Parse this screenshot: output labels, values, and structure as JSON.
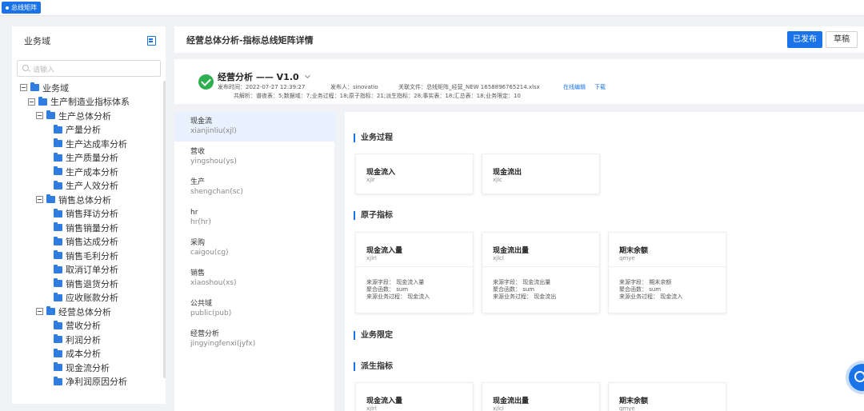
{
  "top_tab": {
    "label": "总线矩阵"
  },
  "sidebar": {
    "title": "业务域",
    "search_placeholder": "请输入",
    "tree": [
      {
        "label": "业务域",
        "level": 0,
        "type": "group"
      },
      {
        "label": "生产制造业指标体系",
        "level": 1,
        "type": "group"
      },
      {
        "label": "生产总体分析",
        "level": 2,
        "type": "group"
      },
      {
        "label": "产量分析",
        "level": 3,
        "type": "leaf"
      },
      {
        "label": "生产达成率分析",
        "level": 3,
        "type": "leaf"
      },
      {
        "label": "生产质量分析",
        "level": 3,
        "type": "leaf"
      },
      {
        "label": "生产成本分析",
        "level": 3,
        "type": "leaf"
      },
      {
        "label": "生产人效分析",
        "level": 3,
        "type": "leaf"
      },
      {
        "label": "销售总体分析",
        "level": 2,
        "type": "group"
      },
      {
        "label": "销售拜访分析",
        "level": 3,
        "type": "leaf"
      },
      {
        "label": "销售销量分析",
        "level": 3,
        "type": "leaf"
      },
      {
        "label": "销售达成分析",
        "level": 3,
        "type": "leaf"
      },
      {
        "label": "销售毛利分析",
        "level": 3,
        "type": "leaf"
      },
      {
        "label": "取消订单分析",
        "level": 3,
        "type": "leaf"
      },
      {
        "label": "销售退货分析",
        "level": 3,
        "type": "leaf"
      },
      {
        "label": "应收账款分析",
        "level": 3,
        "type": "leaf"
      },
      {
        "label": "经营总体分析",
        "level": 2,
        "type": "group"
      },
      {
        "label": "营收分析",
        "level": 3,
        "type": "leaf"
      },
      {
        "label": "利润分析",
        "level": 3,
        "type": "leaf"
      },
      {
        "label": "成本分析",
        "level": 3,
        "type": "leaf"
      },
      {
        "label": "现金流分析",
        "level": 3,
        "type": "leaf"
      },
      {
        "label": "净利润原因分析",
        "level": 3,
        "type": "leaf"
      }
    ]
  },
  "header": {
    "title": "经营总体分析-指标总线矩阵详情",
    "published_label": "已发布",
    "draft_label": "草稿"
  },
  "info": {
    "version_title": "经营分析 —— V1.0",
    "publish_time": "发布时间：2022-07-27 12:39:27",
    "publisher": "发布人：sinovatio",
    "related_file": "关联文件：总线矩阵_经营_NEW 1658896765214.xlsx",
    "online_edit": "在线编辑",
    "download": "下载",
    "parse_summary": "共解析：谱夜表：5;数据域：7;业务过程：18;原子指标：21;派生指标：28;事实表：18;汇总表：18;业务限定：10"
  },
  "categories": [
    {
      "name": "现金流",
      "pinyin": "xianjinliu(xjl)",
      "active": true
    },
    {
      "name": "营收",
      "pinyin": "yingshou(ys)",
      "active": false
    },
    {
      "name": "生产",
      "pinyin": "shengchan(sc)",
      "active": false
    },
    {
      "name": "hr",
      "pinyin": "hr(hr)",
      "active": false
    },
    {
      "name": "采购",
      "pinyin": "caigou(cg)",
      "active": false
    },
    {
      "name": "销售",
      "pinyin": "xiaoshou(xs)",
      "active": false
    },
    {
      "name": "公共域",
      "pinyin": "public(pub)",
      "active": false
    },
    {
      "name": "经营分析",
      "pinyin": "jingyingfenxi(jyfx)",
      "active": false
    }
  ],
  "sections": {
    "business_process": {
      "title": "业务过程",
      "cards": [
        {
          "title": "现金流入",
          "code": "xjlr"
        },
        {
          "title": "现金流出",
          "code": "xjlc"
        }
      ]
    },
    "atomic_metrics": {
      "title": "原子指标",
      "cards": [
        {
          "title": "现金流入量",
          "code": "xjlrl",
          "source_field": "来源字段：  现金流入量",
          "agg_func": "聚合函数：  sum",
          "source_process": "来源业务过程：  现金流入"
        },
        {
          "title": "现金流出量",
          "code": "xjlcl",
          "source_field": "来源字段：  现金流出量",
          "agg_func": "聚合函数：  sum",
          "source_process": "来源业务过程：  现金流出"
        },
        {
          "title": "期末余额",
          "code": "qmye",
          "source_field": "来源字段：  期末余额",
          "agg_func": "聚合函数：  sum",
          "source_process": "来源业务过程：  现金流入"
        }
      ]
    },
    "business_limit": {
      "title": "业务限定"
    },
    "derived_metrics": {
      "title": "派生指标",
      "cards": [
        {
          "title": "现金流入量",
          "code": "xjlrl"
        },
        {
          "title": "现金流出量",
          "code": "xjlcl"
        },
        {
          "title": "期末余额",
          "code": "qmye"
        }
      ]
    }
  }
}
